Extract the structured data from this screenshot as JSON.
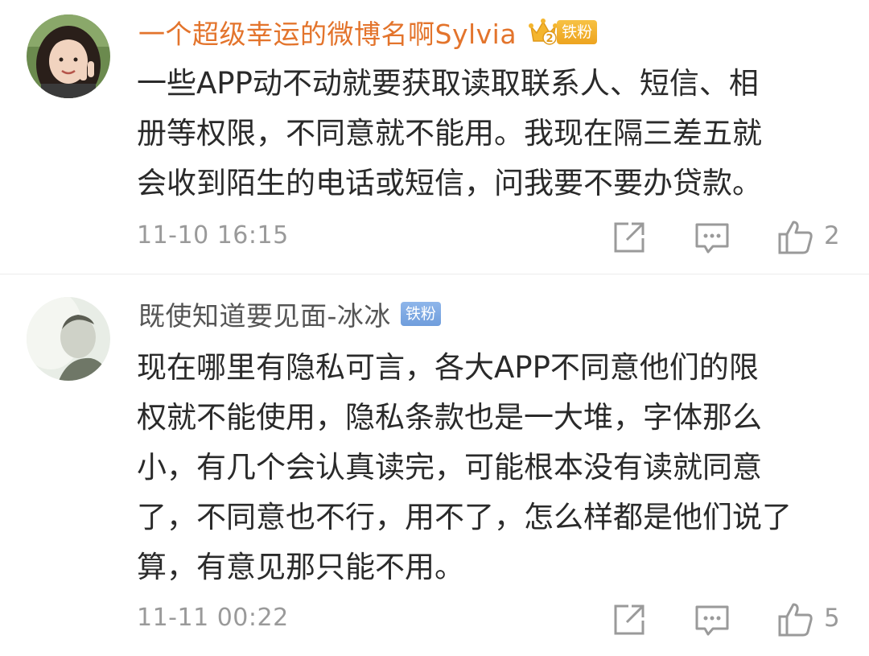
{
  "comments": [
    {
      "username": "一个超级幸运的微博名啊Sylvia",
      "badge": "铁粉",
      "text": "一些APP动不动就要获取读取联系人、短信、相\n册等权限，不同意就不能用。我现在隔三差五就\n会收到陌生的电话或短信，问我要不要办贷款。",
      "time": "11-10 16:15",
      "likes": "2",
      "crown_level": "2"
    },
    {
      "username": "既使知道要见面-冰冰",
      "badge": "铁粉",
      "text": "现在哪里有隐私可言，各大APP不同意他们的限\n权就不能使用，隐私条款也是一大堆，字体那么\n小，有几个会认真读完，可能根本没有读就同意\n了，不同意也不行，用不了，怎么样都是他们说了\n算，有意见那只能不用。",
      "time": "11-11 00:22",
      "likes": "5"
    }
  ],
  "colors": {
    "vip_name": "#e3742c",
    "normal_name": "#555555",
    "gold_badge": "#eda41f",
    "blue_badge": "#6f9ddc",
    "meta": "#9a9a9a"
  },
  "icons": [
    "share-icon",
    "comment-icon",
    "like-icon",
    "crown-icon"
  ]
}
